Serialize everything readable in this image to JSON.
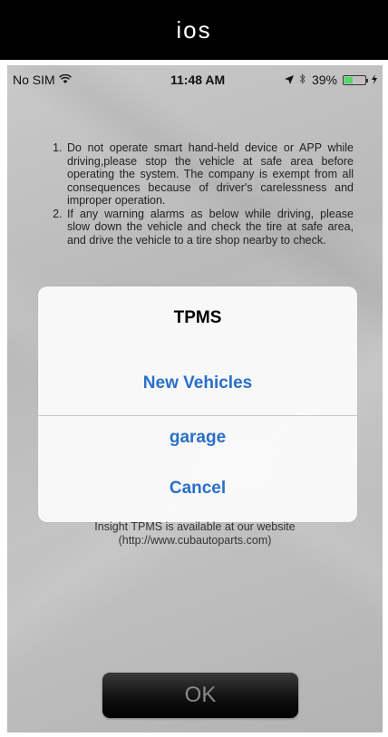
{
  "banner": {
    "title": "ios"
  },
  "status_bar": {
    "carrier": "No SIM",
    "time": "11:48 AM",
    "battery": "39%",
    "battery_level": 0.39
  },
  "notice": {
    "items": [
      "Do not operate smart hand-held device or APP while driving,please stop the vehicle at safe area before operating the system. The company is exempt from all consequences because of driver's carelessness and improper operation.",
      "If any warning alarms as below while driving, please slow down the vehicle and check the tire at safe area, and drive the vehicle to a tire shop nearby to check."
    ]
  },
  "dialog": {
    "title": "TPMS",
    "new_vehicles_label": "New Vehicles",
    "garage_label": "garage",
    "cancel_label": "Cancel"
  },
  "website": {
    "line1": "Insight TPMS is available at our website",
    "line2": "(http://www.cubautoparts.com)"
  },
  "ok_button": {
    "label": "OK"
  },
  "colors": {
    "accent": "#2a6fc9",
    "battery_fill": "#4cd964"
  }
}
